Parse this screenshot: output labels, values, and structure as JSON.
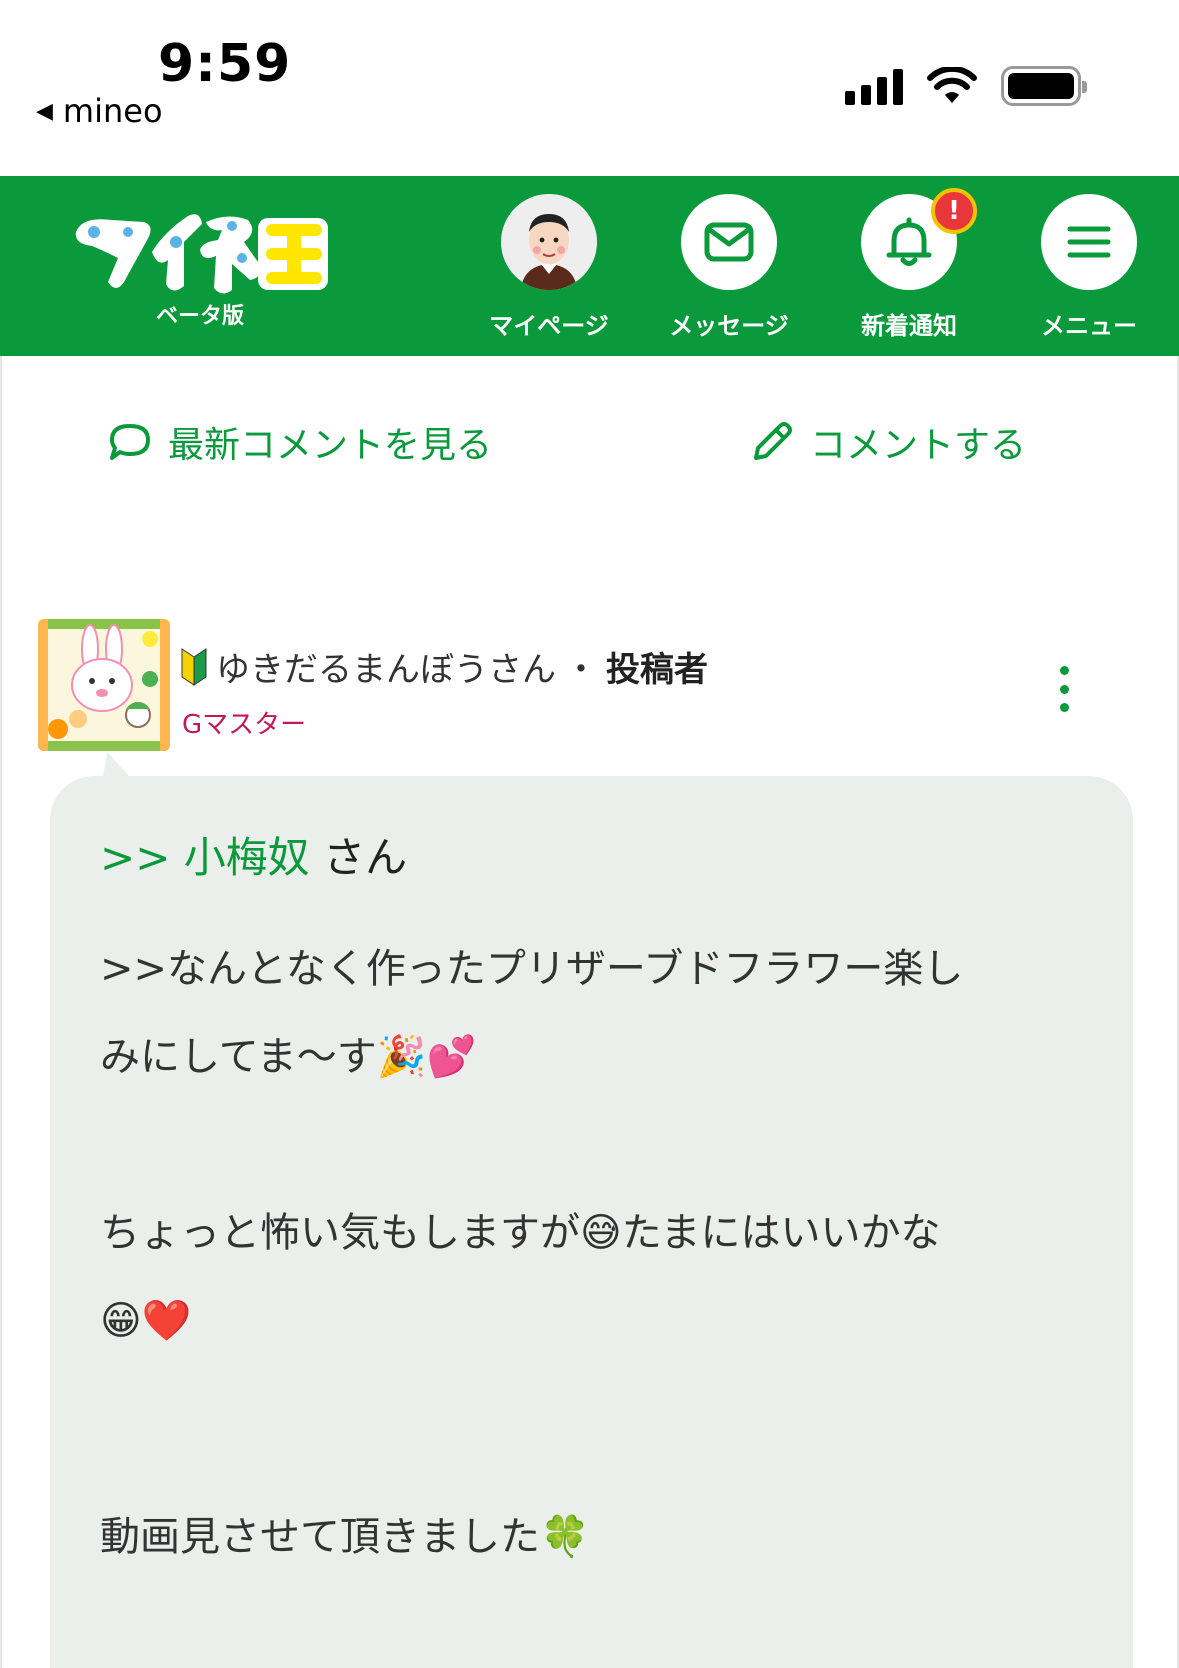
{
  "status_bar": {
    "time": "9:59",
    "back_app": "mineo"
  },
  "header": {
    "logo_text": "マイネ王",
    "logo_sub": "ベータ版",
    "nav": [
      {
        "label": "マイページ"
      },
      {
        "label": "メッセージ"
      },
      {
        "label": "新着通知",
        "badge": "!"
      },
      {
        "label": "メニュー"
      }
    ]
  },
  "actions": {
    "latest_comments": "最新コメントを見る",
    "comment": "コメントする"
  },
  "comment": {
    "author": "ゆきだるまんぼうさん",
    "separator": "・",
    "role": "投稿者",
    "rank": "Gマスター",
    "reply_prefix": ">> ",
    "reply_name": "小梅奴",
    "reply_suffix": " さん",
    "lines": [
      ">>なんとなく作ったプリザーブドフラワー楽し",
      "みにしてま〜す🎉💕",
      "",
      "ちょっと怖い気もしますが😅たまにはいいかな",
      "😁❤️",
      "",
      "",
      "",
      "動画見させて頂きました🍀"
    ]
  },
  "colors": {
    "brand_green": "#0a9a3c",
    "rank_color": "#c2185b",
    "bubble_bg": "#ebefec",
    "badge_red": "#e8363b"
  }
}
